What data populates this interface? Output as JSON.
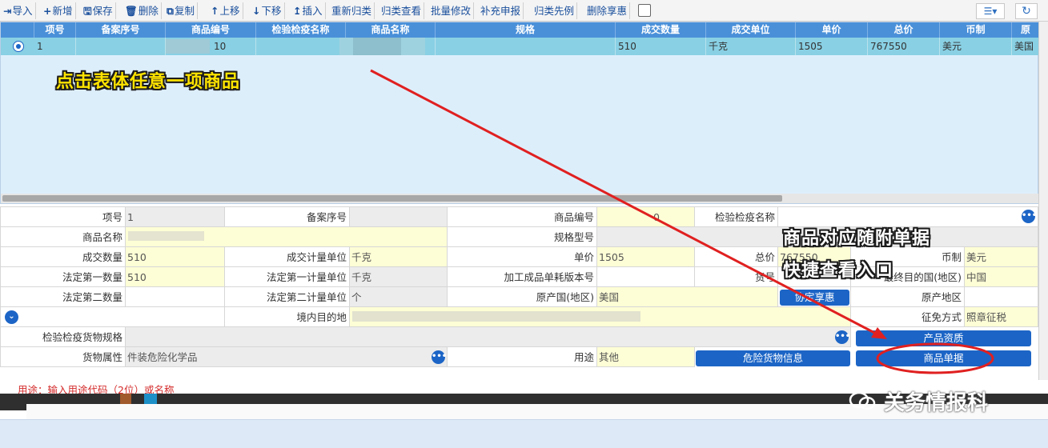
{
  "toolbar": {
    "items": [
      {
        "icon": "⇥",
        "label": "导入"
      },
      {
        "icon": "+",
        "label": "新增"
      },
      {
        "icon": "🖫",
        "label": "保存"
      },
      {
        "icon": "🗑",
        "label": "删除"
      },
      {
        "icon": "⧉",
        "label": "复制"
      },
      {
        "icon": "↑",
        "label": "上移"
      },
      {
        "icon": "↓",
        "label": "下移"
      },
      {
        "icon": "↥",
        "label": "插入"
      },
      {
        "icon": "",
        "label": "重新归类"
      },
      {
        "icon": "",
        "label": "归类查看"
      },
      {
        "icon": "",
        "label": "批量修改"
      },
      {
        "icon": "",
        "label": "补充申报"
      },
      {
        "icon": "",
        "label": "归类先例"
      },
      {
        "icon": "",
        "label": "删除享惠"
      }
    ],
    "menu_icon": "list-icon",
    "refresh_icon": "refresh-icon"
  },
  "grid": {
    "columns": [
      "项号",
      "备案序号",
      "商品编号",
      "检验检疫名称",
      "商品名称",
      "规格",
      "成交数量",
      "成交单位",
      "单价",
      "总价",
      "币制",
      "原"
    ],
    "rows": [
      {
        "index": "1",
        "record_no": "",
        "goods_code": "10",
        "ciq_name": "",
        "goods_name": "",
        "spec": "",
        "qty": "510",
        "unit": "千克",
        "price": "1505",
        "total": "767550",
        "currency": "美元",
        "origin": "美国"
      }
    ]
  },
  "form": {
    "item_no_label": "项号",
    "item_no": "1",
    "record_no_label": "备案序号",
    "record_no": "",
    "goods_code_label": "商品编号",
    "goods_code": "0",
    "ciq_name_label": "检验检疫名称",
    "ciq_name": "",
    "goods_name_label": "商品名称",
    "goods_name": "",
    "model_label": "规格型号",
    "model": "",
    "qty_label": "成交数量",
    "qty": "510",
    "qty_unit_label": "成交计量单位",
    "qty_unit": "千克",
    "price_label": "单价",
    "price": "1505",
    "total_label": "总价",
    "total": "767550",
    "currency_label": "币制",
    "currency": "美元",
    "legal_qty1_label": "法定第一数量",
    "legal_qty1": "510",
    "legal_unit1_label": "法定第一计量单位",
    "legal_unit1": "千克",
    "consume_ver_label": "加工成品单耗版本号",
    "consume_ver": "",
    "goods_no_label": "货号",
    "goods_no": "",
    "final_dest_label": "最终目的国(地区)",
    "final_dest": "中国",
    "legal_qty2_label": "法定第二数量",
    "legal_qty2": "",
    "legal_unit2_label": "法定第二计量单位",
    "legal_unit2": "个",
    "origin_country_label": "原产国(地区)",
    "origin_country": "美国",
    "agreement_btn": "协定享惠",
    "origin_region_label": "原产地区",
    "origin_region": "",
    "domestic_dest_label": "境内目的地",
    "domestic_dest": "",
    "tax_mode_label": "征免方式",
    "tax_mode": "照章征税",
    "ciq_spec_label": "检验检疫货物规格",
    "ciq_spec": "",
    "product_qual_btn": "产品资质",
    "goods_attr_label": "货物属性",
    "goods_attr": "件装危险化学品",
    "usage_label": "用途",
    "usage": "其他",
    "dangerous_btn": "危险货物信息",
    "goods_docs_btn": "商品单据"
  },
  "status": {
    "hint": "用途：输入用途代码（2位）或名称"
  },
  "annotations": {
    "click_hint": "点击表体任意一项商品",
    "docs_line1": "商品对应随附单据",
    "docs_line2": "快捷查看入口"
  },
  "watermark": {
    "text": "关务情报科"
  },
  "colors": {
    "header_blue": "#4a90d9",
    "selected_row": "#89d0e4",
    "button_blue": "#1c65c6",
    "annotation_yellow": "#ffe400",
    "arrow_red": "#e02020"
  }
}
